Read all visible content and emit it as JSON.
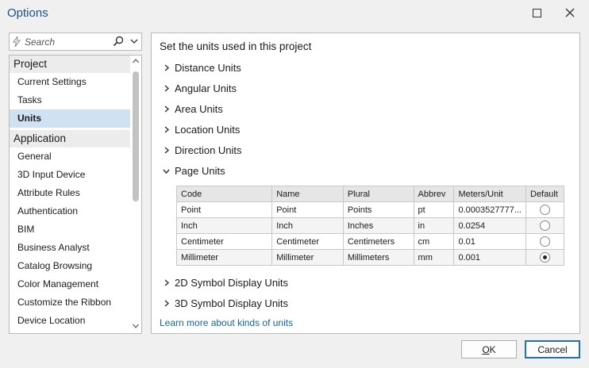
{
  "window": {
    "title": "Options"
  },
  "search": {
    "placeholder": "Search"
  },
  "nav": {
    "project_group": "Project",
    "project_items": [
      "Current Settings",
      "Tasks",
      "Units"
    ],
    "application_group": "Application",
    "application_items": [
      "General",
      "3D Input Device",
      "Attribute Rules",
      "Authentication",
      "BIM",
      "Business Analyst",
      "Catalog Browsing",
      "Color Management",
      "Customize the Ribbon",
      "Device Location"
    ],
    "selected": "Units"
  },
  "main": {
    "heading": "Set the units used in this project",
    "sections": [
      "Distance Units",
      "Angular Units",
      "Area Units",
      "Location Units",
      "Direction Units",
      "Page Units"
    ],
    "expanded_section": "Page Units",
    "sections_after": [
      "2D Symbol Display Units",
      "3D Symbol Display Units"
    ],
    "learn_more": "Learn more about kinds of units"
  },
  "page_units_table": {
    "headers": [
      "Code",
      "Name",
      "Plural",
      "Abbrev",
      "Meters/Unit",
      "Default"
    ],
    "rows": [
      {
        "code": "Point",
        "name": "Point",
        "plural": "Points",
        "abbrev": "pt",
        "meters": "0.0003527777...",
        "default": false
      },
      {
        "code": "Inch",
        "name": "Inch",
        "plural": "Inches",
        "abbrev": "in",
        "meters": "0.0254",
        "default": false
      },
      {
        "code": "Centimeter",
        "name": "Centimeter",
        "plural": "Centimeters",
        "abbrev": "cm",
        "meters": "0.01",
        "default": false
      },
      {
        "code": "Millimeter",
        "name": "Millimeter",
        "plural": "Millimeters",
        "abbrev": "mm",
        "meters": "0.001",
        "default": true
      }
    ]
  },
  "buttons": {
    "ok_accel": "O",
    "ok_rest": "K",
    "cancel": "Cancel"
  },
  "colors": {
    "title": "#1a4f8a",
    "selection": "#cfe1f3",
    "link": "#1464a5",
    "focus_border": "#1f6fc4"
  },
  "icons": [
    "lightning-icon",
    "search-icon",
    "chevron-down-icon",
    "chevron-right-icon",
    "maximize-icon",
    "close-icon"
  ]
}
